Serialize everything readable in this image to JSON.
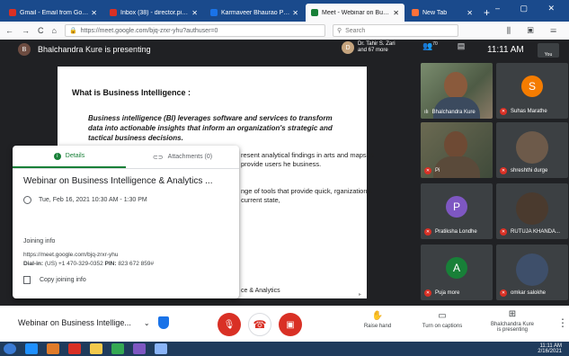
{
  "browser": {
    "tabs": [
      {
        "title": "Gmail - Email from Google",
        "color": "#d93025",
        "active": false
      },
      {
        "title": "Inbox (38) - director.pimer",
        "color": "#d93025",
        "active": false
      },
      {
        "title": "Karmaveer Bhaurao Patil Coll",
        "color": "#1a73e8",
        "active": false
      },
      {
        "title": "Meet - Webinar on Busine",
        "color": "#188038",
        "active": true
      },
      {
        "title": "New Tab",
        "color": "#ff7139",
        "active": false
      }
    ],
    "new_tab": "+",
    "window_controls": "– ▢ ✕",
    "url": "https://meet.google.com/bjq-zrxr-yhu?authuser=0",
    "search_placeholder": "Search",
    "nav_back": "←",
    "nav_forward": "→",
    "nav_reload": "C",
    "nav_home": "⌂"
  },
  "meet": {
    "presenter_initial": "B",
    "presenter_text": "Bhalchandra Kure is presenting",
    "other_presenter_initial": "D",
    "other_presenter_line1": "Dr. Tahir S. Zari",
    "other_presenter_line2": "and 67 more",
    "participants_count": "70",
    "clock": "11:11 AM",
    "you_label": "You"
  },
  "slide": {
    "title": "What is Business Intelligence :",
    "definition": "Business intelligence (BI) leverages software and services to transform data into actionable insights that inform an organization's strategic and tactical business decisions.",
    "bullet1": "resent analytical findings in arts and maps to provide users he business.",
    "bullet2": "nge of tools that provide quick, rganization's current state,",
    "footer": "ce & Analytics"
  },
  "details": {
    "tab_details": "Details",
    "tab_attachments": "Attachments (0)",
    "meeting_title": "Webinar on Business Intelligence & Analytics ...",
    "date": "Tue, Feb 16, 2021 10:30 AM - 1:30 PM",
    "joining_header": "Joining info",
    "joining_url": "https://meet.google.com/bjq-zrxr-yhu",
    "dial_label": "Dial-in:",
    "dial_number": "(US) +1 470-329-0352",
    "pin_label": "PIN:",
    "pin": "823 672 859#",
    "copy_label": "Copy joining info"
  },
  "participants": [
    {
      "name": "Bhalchandra Kure",
      "type": "video",
      "muted": false
    },
    {
      "name": "Suhas Marathe",
      "type": "avatar",
      "initial": "S",
      "color": "#f57c00",
      "muted": true
    },
    {
      "name": "Pi",
      "type": "video",
      "muted": true
    },
    {
      "name": "shreshthi durge",
      "type": "photo",
      "muted": true
    },
    {
      "name": "Pratiksha Londhe",
      "type": "avatar",
      "initial": "P",
      "color": "#7e57c2",
      "muted": true
    },
    {
      "name": "RUTUJA KHANDA...",
      "type": "photo",
      "muted": true
    },
    {
      "name": "Puja more",
      "type": "avatar",
      "initial": "A",
      "color": "#188038",
      "muted": true
    },
    {
      "name": "omkar salokhe",
      "type": "photo",
      "muted": true
    }
  ],
  "bottom": {
    "meeting_name": "Webinar on Business Intellige...",
    "raise_hand": "Raise hand",
    "captions": "Turn on captions",
    "presenting_line1": "Bhalchandra Kure",
    "presenting_line2": "is presenting"
  },
  "taskbar": {
    "time": "11:11 AM",
    "date": "2/16/2021"
  }
}
